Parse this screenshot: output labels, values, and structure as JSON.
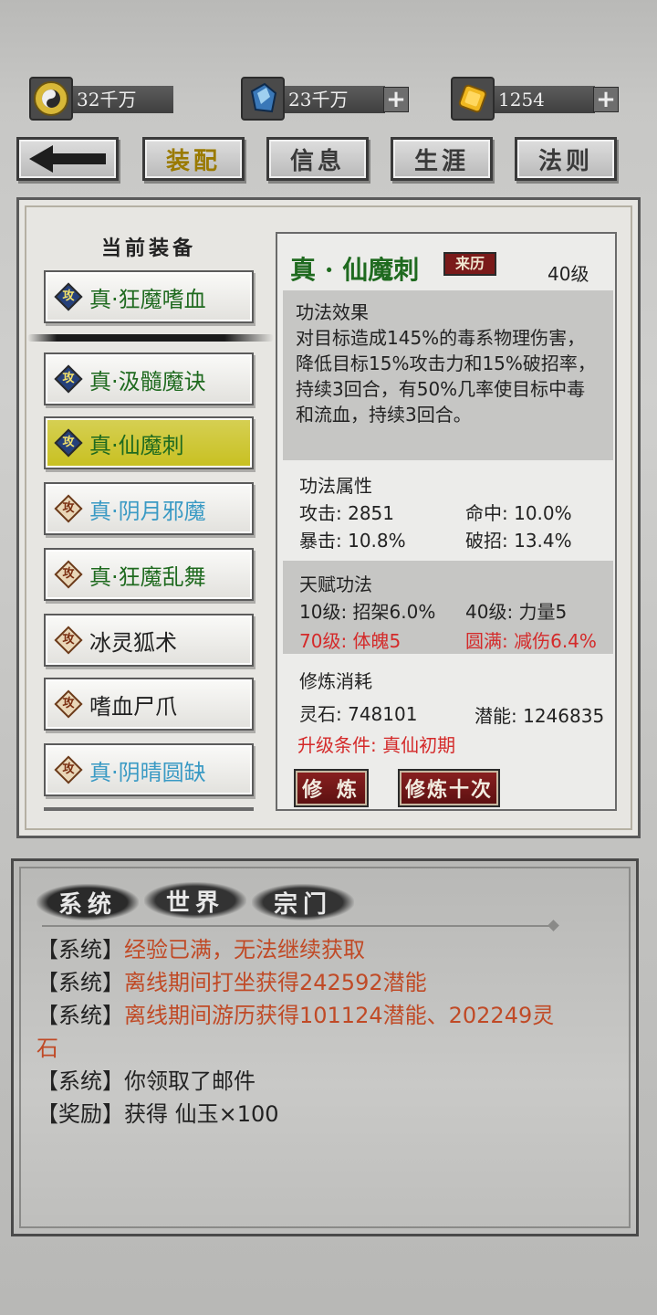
{
  "currencies": [
    {
      "icon": "bagua-icon",
      "value": "32千万",
      "has_plus": false
    },
    {
      "icon": "crystal-icon",
      "value": "23千万",
      "has_plus": true
    },
    {
      "icon": "gold-ingot-icon",
      "value": "1254",
      "has_plus": true
    }
  ],
  "nav": {
    "back": "back-arrow-icon",
    "tabs": [
      "装配",
      "信息",
      "生涯",
      "法则"
    ],
    "active_tab": "装配"
  },
  "equip": {
    "title": "当前装备",
    "items": [
      {
        "label": "真·狂魔嗜血",
        "badge": "攻",
        "badge_style": "blue",
        "color": "#1f6a1f"
      },
      {
        "label": "真·汲髓魔诀",
        "badge": "攻",
        "badge_style": "blue",
        "color": "#1f6a1f"
      },
      {
        "label": "真·仙魔刺",
        "badge": "攻",
        "badge_style": "blue",
        "color": "#1f6a1f",
        "selected": true
      },
      {
        "label": "真·阴月邪魔",
        "badge": "攻",
        "badge_style": "brown",
        "color": "#3a9ac4"
      },
      {
        "label": "真·狂魔乱舞",
        "badge": "攻",
        "badge_style": "brown",
        "color": "#1f6a1f"
      },
      {
        "label": "冰灵狐术",
        "badge": "攻",
        "badge_style": "brown",
        "color": "#222222"
      },
      {
        "label": "嗜血尸爪",
        "badge": "攻",
        "badge_style": "brown",
        "color": "#222222"
      },
      {
        "label": "真·阴晴圆缺",
        "badge": "攻",
        "badge_style": "brown",
        "color": "#3a9ac4"
      }
    ]
  },
  "detail": {
    "name": "真 · 仙魔刺",
    "origin_button": "来历",
    "level": "40级",
    "effect_title": "功法效果",
    "effect_lines": [
      "对目标造成145%的毒系物理伤害，",
      "降低目标15%攻击力和15%破招率，",
      "持续3回合，有50%几率使目标中毒",
      "和流血，持续3回合。"
    ],
    "attr_title": "功法属性",
    "attrs": [
      {
        "label": "攻击: 2851"
      },
      {
        "label": "命中: 10.0%"
      },
      {
        "label": "暴击: 10.8%"
      },
      {
        "label": "破招: 13.4%"
      }
    ],
    "talent_title": "天赋功法",
    "talents": [
      {
        "label": "10级: 招架6.0%",
        "red": false
      },
      {
        "label": "40级: 力量5",
        "red": false
      },
      {
        "label": "70级: 体魄5",
        "red": true
      },
      {
        "label": "圆满: 减伤6.4%",
        "red": true
      }
    ],
    "cost_title": "修炼消耗",
    "cost_stone": "灵石: 748101",
    "cost_potential": "潜能: 1246835",
    "upgrade_condition": "升级条件: 真仙初期",
    "train_button": "修 炼",
    "train10_button": "修炼十次"
  },
  "chat": {
    "tabs": [
      "系统",
      "世界",
      "宗门"
    ],
    "messages": [
      {
        "tag": "【系统】",
        "text": "经验已满，无法继续获取",
        "highlight": true
      },
      {
        "tag": "【系统】",
        "text": "离线期间打坐获得242592潜能",
        "highlight": true
      },
      {
        "tag": "【系统】",
        "text": "离线期间游历获得101124潜能、202249灵",
        "highlight": true,
        "wrap": "石"
      },
      {
        "tag": "【系统】",
        "text": "你领取了邮件",
        "highlight": false
      },
      {
        "tag": "【奖励】",
        "text": "获得 仙玉×100",
        "highlight": false
      }
    ]
  },
  "colors": {
    "selected_item": "#cfc72a",
    "red_text": "#d42a2a",
    "chat_highlight": "#c04a26",
    "title_green": "#1f6a1f"
  }
}
